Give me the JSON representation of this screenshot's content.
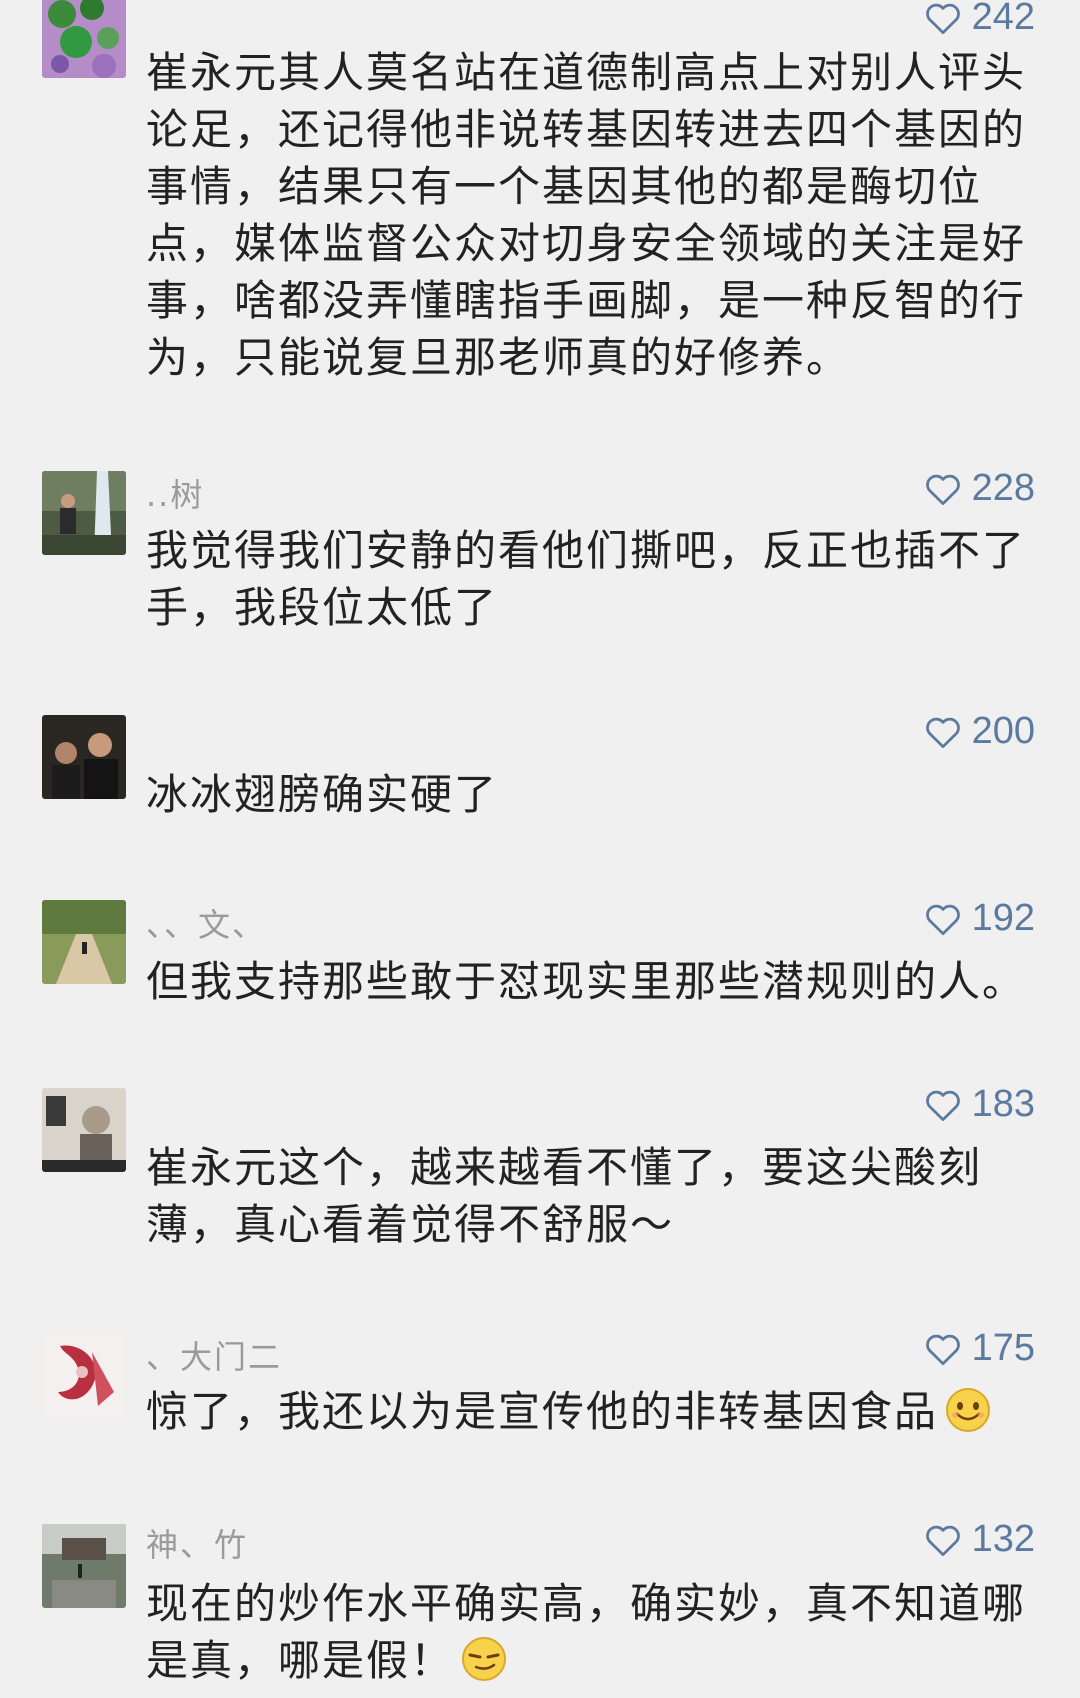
{
  "comments": [
    {
      "username": "",
      "likes": "242",
      "text": "崔永元其人莫名站在道德制高点上对别人评头论足，还记得他非说转基因转进去四个基因的事情，结果只有一个基因其他的都是酶切位点，媒体监督公众对切身安全领域的关注是好事，啥都没弄懂瞎指手画脚，是一种反智的行为，只能说复旦那老师真的好修养。"
    },
    {
      "username": "..树",
      "likes": "228",
      "text": "我觉得我们安静的看他们撕吧，反正也插不了手，我段位太低了"
    },
    {
      "username": "",
      "likes": "200",
      "text": "冰冰翅膀确实硬了"
    },
    {
      "username": "、、文、",
      "likes": "192",
      "text": "但我支持那些敢于怼现实里那些潜规则的人。"
    },
    {
      "username": "",
      "likes": "183",
      "text": "崔永元这个，越来越看不懂了，要这尖酸刻薄，真心看着觉得不舒服～"
    },
    {
      "username": "、大门二",
      "likes": "175",
      "text": "惊了，我还以为是宣传他的非转基因食品",
      "emoji": "smile-emoji"
    },
    {
      "username": "神、竹",
      "likes": "132",
      "text": "现在的炒作水平确实高，确实妙，真不知道哪是真，哪是假！",
      "emoji": "smirk-emoji"
    }
  ]
}
